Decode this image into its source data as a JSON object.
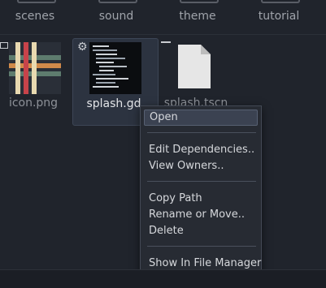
{
  "folders": [
    {
      "label": "scenes"
    },
    {
      "label": "sound"
    },
    {
      "label": "theme"
    },
    {
      "label": "tutorial"
    }
  ],
  "files": [
    {
      "label": "icon.png",
      "icon": "image-thumbnail-icon"
    },
    {
      "label": "splash.gd",
      "icon": "script-thumbnail-icon",
      "selected": true
    },
    {
      "label": "splash.tscn",
      "icon": "scene-file-icon"
    }
  ],
  "context_menu": {
    "items": [
      {
        "label": "Open",
        "highlighted": true
      },
      {
        "label": "Edit Dependencies.."
      },
      {
        "label": "View Owners.."
      },
      {
        "label": "Copy Path"
      },
      {
        "label": "Rename or Move.."
      },
      {
        "label": "Delete"
      },
      {
        "label": "Show In File Manager"
      }
    ]
  },
  "colors": {
    "background": "#20242c",
    "menu_background": "#272b33",
    "highlight": "#3b4251"
  }
}
